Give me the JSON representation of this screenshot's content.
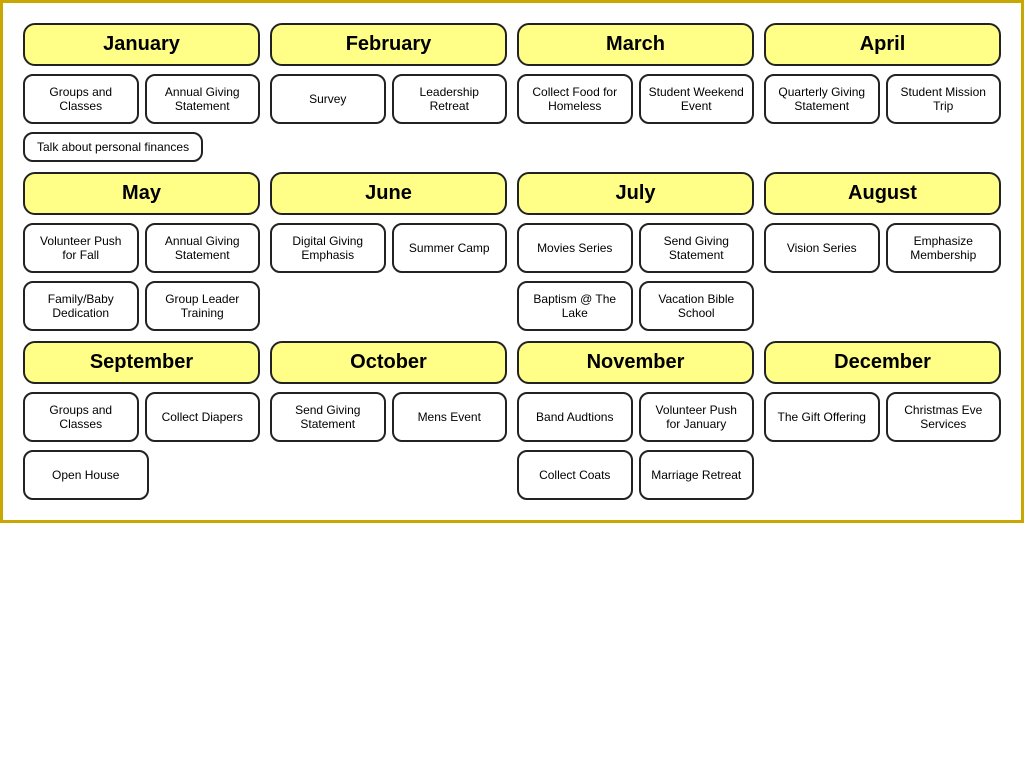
{
  "months": [
    {
      "name": "January",
      "rows": [
        [
          {
            "text": "Groups and Classes"
          },
          {
            "text": "Annual Giving Statement"
          }
        ]
      ],
      "note": "Talk about personal finances"
    },
    {
      "name": "February",
      "rows": [
        [
          {
            "text": "Survey"
          },
          {
            "text": "Leadership Retreat"
          }
        ]
      ]
    },
    {
      "name": "March",
      "rows": [
        [
          {
            "text": "Collect Food for Homeless"
          },
          {
            "text": "Student Weekend Event"
          }
        ]
      ]
    },
    {
      "name": "April",
      "rows": [
        [
          {
            "text": "Quarterly Giving Statement"
          },
          {
            "text": "Student Mission Trip"
          }
        ]
      ]
    },
    {
      "name": "May",
      "rows": [
        [
          {
            "text": "Volunteer Push for Fall"
          },
          {
            "text": "Annual Giving Statement"
          }
        ],
        [
          {
            "text": "Family/Baby Dedication"
          },
          {
            "text": "Group Leader Training"
          }
        ]
      ]
    },
    {
      "name": "June",
      "rows": [
        [
          {
            "text": "Digital Giving Emphasis"
          },
          {
            "text": "Summer Camp"
          }
        ]
      ]
    },
    {
      "name": "July",
      "rows": [
        [
          {
            "text": "Movies Series"
          },
          {
            "text": "Send Giving Statement"
          }
        ],
        [
          {
            "text": "Baptism @ The Lake"
          },
          {
            "text": "Vacation Bible School"
          }
        ]
      ]
    },
    {
      "name": "August",
      "rows": [
        [
          {
            "text": "Vision Series"
          },
          {
            "text": "Emphasize Membership"
          }
        ]
      ]
    },
    {
      "name": "September",
      "rows": [
        [
          {
            "text": "Groups and Classes"
          },
          {
            "text": "Collect Diapers"
          }
        ],
        [
          {
            "text": "Open House",
            "single": true
          }
        ]
      ]
    },
    {
      "name": "October",
      "rows": [
        [
          {
            "text": "Send Giving Statement"
          },
          {
            "text": "Mens Event"
          }
        ]
      ]
    },
    {
      "name": "November",
      "rows": [
        [
          {
            "text": "Band Audtions"
          },
          {
            "text": "Volunteer Push for January"
          }
        ],
        [
          {
            "text": "Collect Coats"
          },
          {
            "text": "Marriage Retreat"
          }
        ]
      ]
    },
    {
      "name": "December",
      "rows": [
        [
          {
            "text": "The Gift Offering"
          },
          {
            "text": "Christmas Eve Services"
          }
        ]
      ]
    }
  ]
}
